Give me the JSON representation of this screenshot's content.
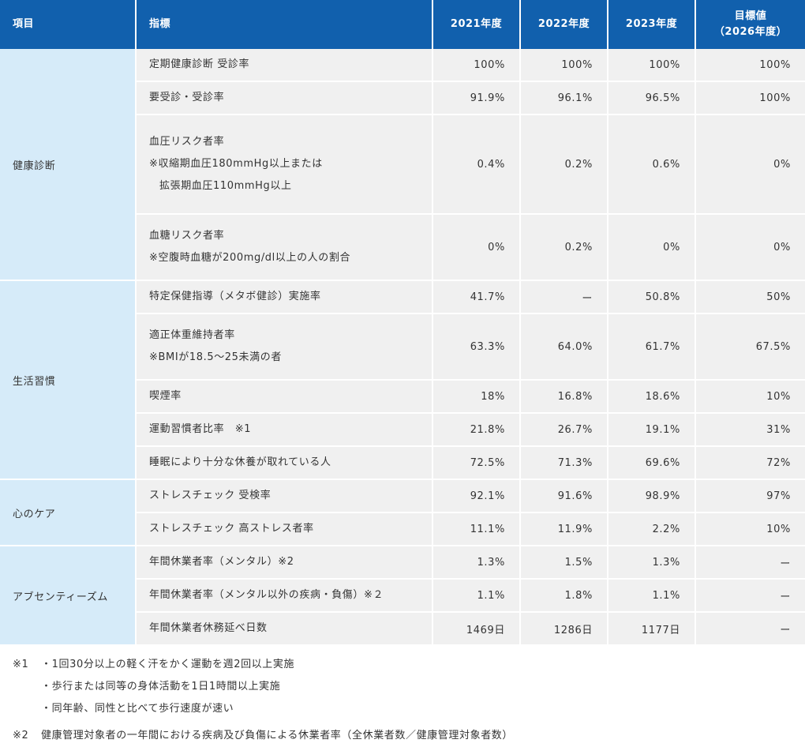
{
  "header": {
    "item": "項目",
    "indicator": "指標",
    "y2021": "2021年度",
    "y2022": "2022年度",
    "y2023": "2023年度",
    "target_line1": "目標値",
    "target_line2": "（2026年度）"
  },
  "categories": {
    "health_checkup": "健康診断",
    "lifestyle": "生活習慣",
    "mental_care": "心のケア",
    "absenteeism": "アブセンティーズム"
  },
  "rows": [
    {
      "label": "定期健康診断 受診率",
      "v2021": "100%",
      "v2022": "100%",
      "v2023": "100%",
      "target": "100%"
    },
    {
      "label": "要受診・受診率",
      "v2021": "91.9%",
      "v2022": "96.1%",
      "v2023": "96.5%",
      "target": "100%"
    },
    {
      "label": "血圧リスク者率",
      "sub1": "※収縮期血圧180mmHg以上または",
      "sub2": "拡張期血圧110mmHg以上",
      "v2021": "0.4%",
      "v2022": "0.2%",
      "v2023": "0.6%",
      "target": "0%"
    },
    {
      "label": "血糖リスク者率",
      "sub1": "※空腹時血糖が200mg/dl以上の人の割合",
      "v2021": "0%",
      "v2022": "0.2%",
      "v2023": "0%",
      "target": "0%"
    },
    {
      "label": "特定保健指導（メタボ健診）実施率",
      "v2021": "41.7%",
      "v2022": "ー",
      "v2023": "50.8%",
      "target": "50%"
    },
    {
      "label": "適正体重維持者率",
      "sub1": "※BMIが18.5〜25未満の者",
      "v2021": "63.3%",
      "v2022": "64.0%",
      "v2023": "61.7%",
      "target": "67.5%"
    },
    {
      "label": "喫煙率",
      "v2021": "18%",
      "v2022": "16.8%",
      "v2023": "18.6%",
      "target": "10%"
    },
    {
      "label": "運動習慣者比率　※1",
      "v2021": "21.8%",
      "v2022": "26.7%",
      "v2023": "19.1%",
      "target": "31%"
    },
    {
      "label": "睡眠により十分な休養が取れている人",
      "v2021": "72.5%",
      "v2022": "71.3%",
      "v2023": "69.6%",
      "target": "72%"
    },
    {
      "label": "ストレスチェック 受検率",
      "v2021": "92.1%",
      "v2022": "91.6%",
      "v2023": "98.9%",
      "target": "97%"
    },
    {
      "label": "ストレスチェック 高ストレス者率",
      "v2021": "11.1%",
      "v2022": "11.9%",
      "v2023": "2.2%",
      "target": "10%"
    },
    {
      "label": "年間休業者率（メンタル）※2",
      "v2021": "1.3%",
      "v2022": "1.5%",
      "v2023": "1.3%",
      "target": "ー"
    },
    {
      "label": "年間休業者率（メンタル以外の疾病・負傷）※２",
      "v2021": "1.1%",
      "v2022": "1.8%",
      "v2023": "1.1%",
      "target": "ー"
    },
    {
      "label": "年間休業者休務延べ日数",
      "v2021": "1469日",
      "v2022": "1286日",
      "v2023": "1177日",
      "target": "ー"
    }
  ],
  "notes": {
    "n1_mark": "※1",
    "n1_line1": "・1回30分以上の軽く汗をかく運動を週2回以上実施",
    "n1_line2": "・歩行または同等の身体活動を1日1時間以上実施",
    "n1_line3": "・同年齢、同性と比べて歩行速度が速い",
    "n2_mark": "※2",
    "n2_line1": "健康管理対象者の一年間における疾病及び負傷による休業者率（全休業者数／健康管理対象者数）"
  }
}
